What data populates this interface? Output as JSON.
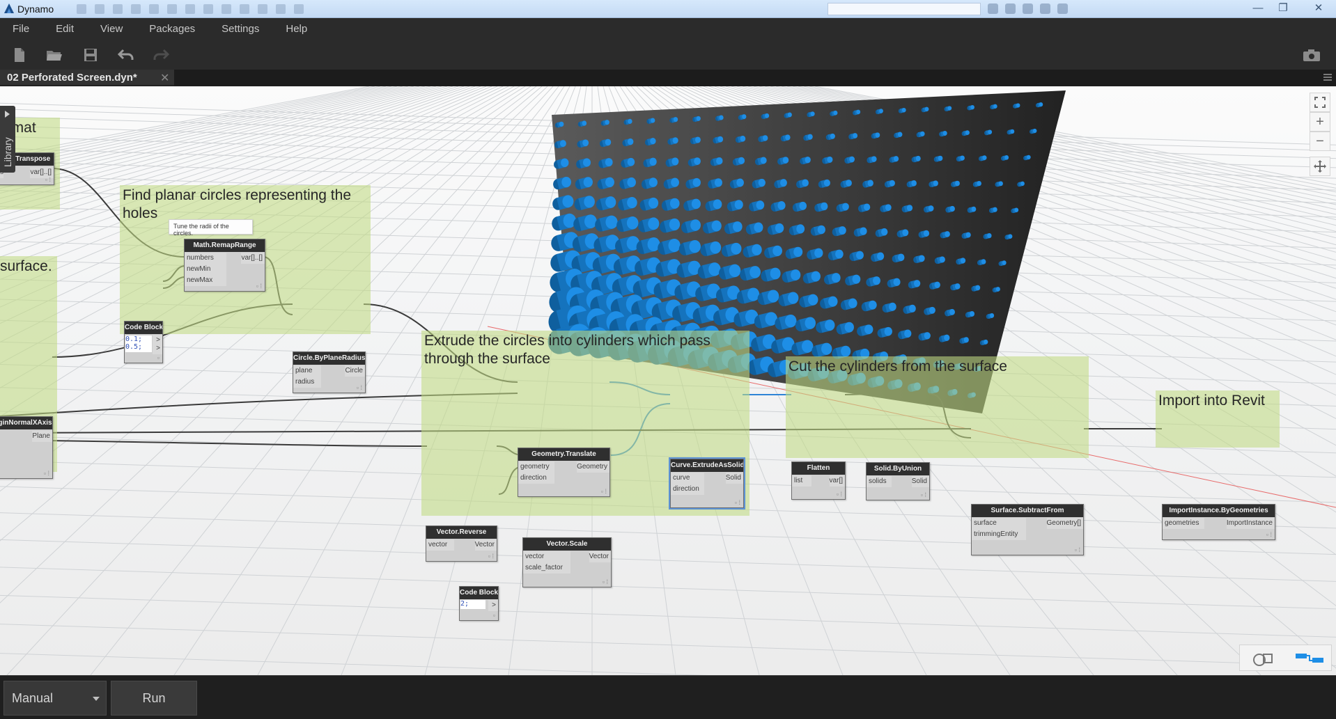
{
  "window": {
    "app_title": "Dynamo",
    "min_label": "—",
    "max_label": "❐",
    "close_label": "✕"
  },
  "menu": [
    "File",
    "Edit",
    "View",
    "Packages",
    "Settings",
    "Help"
  ],
  "toolbar": {
    "icons": [
      "new-file-icon",
      "open-file-icon",
      "save-icon",
      "undo-icon",
      "redo-icon",
      "camera-icon"
    ]
  },
  "tab": {
    "label": "02 Perforated Screen.dyn*",
    "close": "✕"
  },
  "library": {
    "label": "Library"
  },
  "groups": {
    "format": "ormat\ned",
    "planar": "Find planar circles representing the\nholes",
    "surface": "surface.",
    "extrude": "Extrude the circles into cylinders which pass\nthrough the surface",
    "cut": "Cut the cylinders from the surface",
    "import": "Import into Revit"
  },
  "note": "Tune the radii of the circles.",
  "nodes": {
    "transpose": {
      "title": "List.Transpose",
      "in": [
        "s"
      ],
      "out": [
        "var[]..[]"
      ]
    },
    "remap": {
      "title": "Math.RemapRange",
      "in": [
        "numbers",
        "newMin",
        "newMax"
      ],
      "out": [
        "var[]..[]"
      ]
    },
    "codeblock1": {
      "title": "Code Block",
      "lines": [
        "0.1;",
        "0.5;"
      ],
      "out": [
        ">",
        ">"
      ]
    },
    "circle": {
      "title": "Circle.ByPlaneRadius",
      "in": [
        "plane",
        "radius"
      ],
      "out": [
        "Circle"
      ]
    },
    "plane": {
      "title": "ginNormalXAxis",
      "out": [
        "Plane"
      ]
    },
    "translate": {
      "title": "Geometry.Translate",
      "in": [
        "geometry",
        "direction"
      ],
      "out": [
        "Geometry"
      ]
    },
    "extrude": {
      "title": "Curve.ExtrudeAsSolid",
      "in": [
        "curve",
        "direction"
      ],
      "out": [
        "Solid"
      ]
    },
    "reverse": {
      "title": "Vector.Reverse",
      "in": [
        "vector"
      ],
      "out": [
        "Vector"
      ]
    },
    "scale": {
      "title": "Vector.Scale",
      "in": [
        "vector",
        "scale_factor"
      ],
      "out": [
        "Vector"
      ]
    },
    "codeblock2": {
      "title": "Code Block",
      "lines": [
        "2;"
      ],
      "out": [
        ">"
      ]
    },
    "flatten": {
      "title": "Flatten",
      "in": [
        "list"
      ],
      "out": [
        "var[]"
      ]
    },
    "union": {
      "title": "Solid.ByUnion",
      "in": [
        "solids"
      ],
      "out": [
        "Solid"
      ]
    },
    "subtract": {
      "title": "Surface.SubtractFrom",
      "in": [
        "surface",
        "trimmingEntity"
      ],
      "out": [
        "Geometry[]"
      ]
    },
    "import": {
      "title": "ImportInstance.ByGeometries",
      "in": [
        "geometries"
      ],
      "out": [
        "ImportInstance"
      ]
    }
  },
  "navigation": {
    "zoom_in": "+",
    "zoom_out": "−"
  },
  "bottom": {
    "run_mode": "Manual",
    "run": "Run"
  },
  "colors": {
    "accent": "#1e8ee6",
    "group_fill": "#c1da83",
    "node_header": "#2f2f2f",
    "background": "#f3f4f5"
  }
}
